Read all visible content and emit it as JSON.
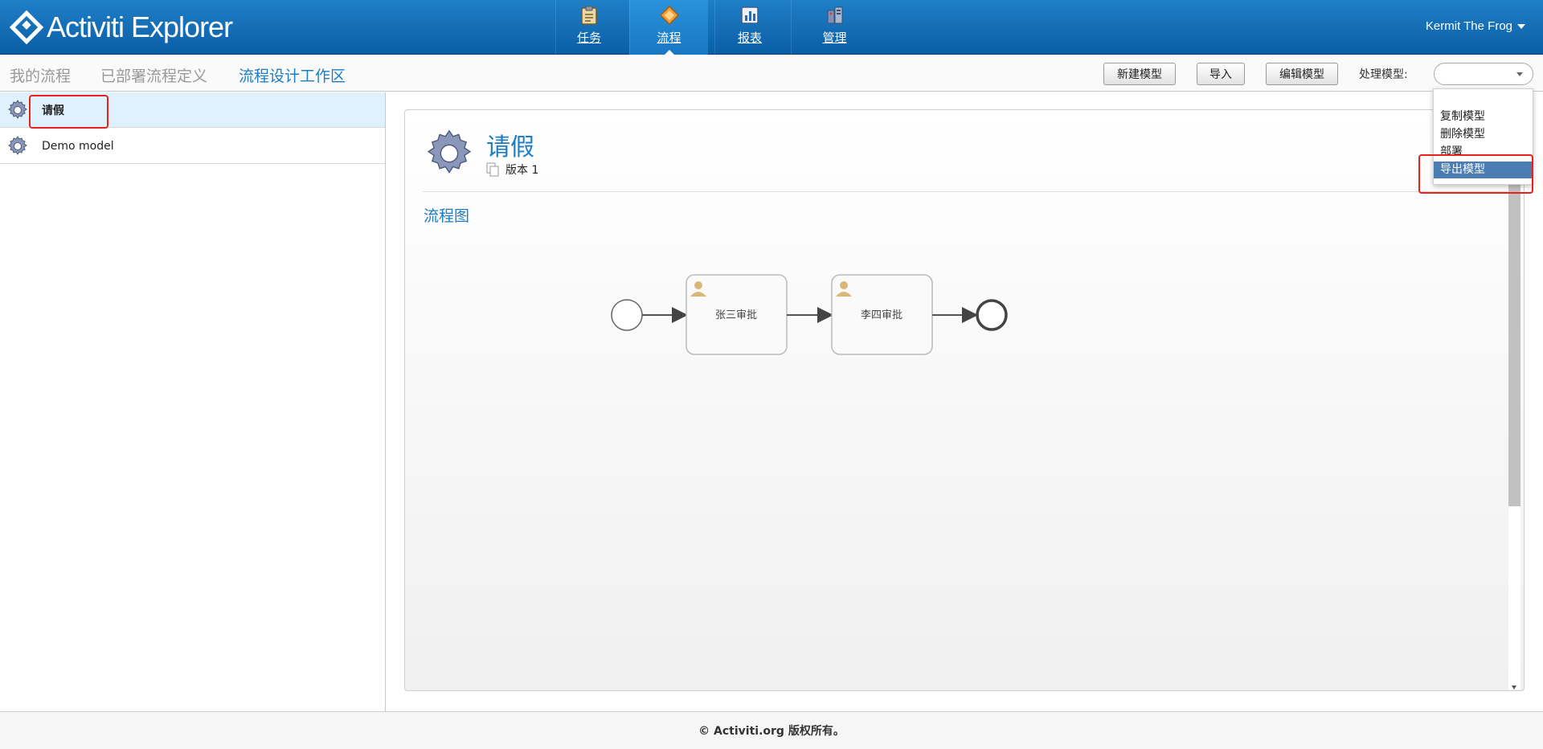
{
  "app": {
    "logo_text": "Activiti Explorer",
    "user_name": "Kermit The Frog"
  },
  "nav": [
    {
      "label": "任务",
      "icon": "clipboard-icon"
    },
    {
      "label": "流程",
      "icon": "process-diamond-icon"
    },
    {
      "label": "报表",
      "icon": "report-chart-icon"
    },
    {
      "label": "管理",
      "icon": "admin-icon"
    }
  ],
  "subnav": {
    "tabs": [
      "我的流程",
      "已部署流程定义",
      "流程设计工作区"
    ],
    "active_tab": "流程设计工作区",
    "new_model": "新建模型",
    "import": "导入",
    "edit_model": "编辑模型",
    "process_model_label": "处理模型:",
    "process_model_value": ""
  },
  "dropdown": {
    "items": [
      "复制模型",
      "删除模型",
      "部署",
      "导出模型"
    ],
    "selected": "导出模型"
  },
  "models": [
    {
      "name": "请假",
      "selected": true
    },
    {
      "name": "Demo model",
      "selected": false
    }
  ],
  "detail": {
    "title": "请假",
    "version": "版本 1",
    "section_title": "流程图",
    "tasks": [
      "张三审批",
      "李四审批"
    ]
  },
  "footer": {
    "text": "© Activiti.org 版权所有。"
  },
  "colors": {
    "header_blue": "#0b5ea6",
    "accent": "#1c7dc4",
    "highlight_red": "#e8211c",
    "selected_row": "#dff1fd",
    "menu_selected": "#4b7db3"
  }
}
